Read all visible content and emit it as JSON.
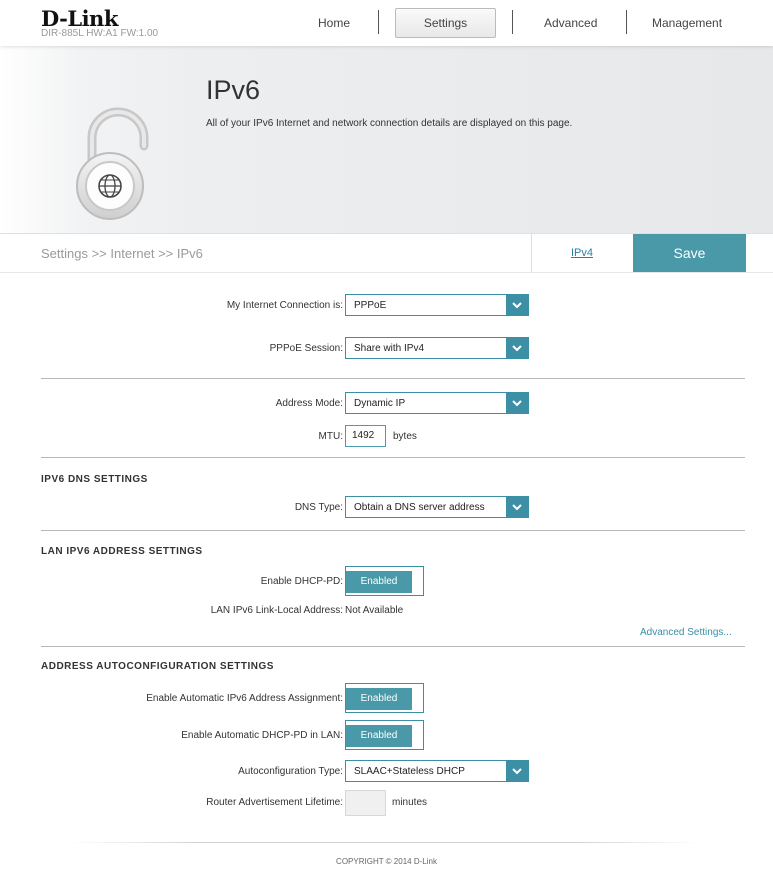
{
  "header": {
    "brand": "D-Link",
    "device_info": "DIR-885L  HW:A1  FW:1.00",
    "nav": [
      "Home",
      "Settings",
      "Advanced",
      "Management"
    ],
    "active_tab": "Settings"
  },
  "banner": {
    "title": "IPv6",
    "description": "All of your IPv6 Internet and network connection details are displayed on this page.",
    "icon": "lock-globe-icon"
  },
  "breadcrumb": "Settings >> Internet >> IPv6",
  "actions": {
    "ipv4_link": "IPv4",
    "save_label": "Save"
  },
  "form": {
    "connection_label": "My Internet Connection is:",
    "connection_value": "PPPoE",
    "session_label": "PPPoE Session:",
    "session_value": "Share with IPv4",
    "address_mode_label": "Address Mode:",
    "address_mode_value": "Dynamic IP",
    "mtu_label": "MTU:",
    "mtu_value": "1492",
    "mtu_unit": "bytes"
  },
  "dns": {
    "section_title": "IPV6 DNS SETTINGS",
    "dns_type_label": "DNS Type:",
    "dns_type_value": "Obtain a DNS server address"
  },
  "lan": {
    "section_title": "LAN IPV6 ADDRESS SETTINGS",
    "dhcp_pd_label": "Enable DHCP-PD:",
    "dhcp_pd_value": "Enabled",
    "link_local_label": "LAN IPv6 Link-Local Address:",
    "link_local_value": "Not Available",
    "advanced_link": "Advanced Settings..."
  },
  "autoconfig": {
    "section_title": "ADDRESS AUTOCONFIGURATION SETTINGS",
    "auto_assign_label": "Enable Automatic IPv6 Address Assignment:",
    "auto_assign_value": "Enabled",
    "auto_dhcp_label": "Enable Automatic DHCP-PD in LAN:",
    "auto_dhcp_value": "Enabled",
    "type_label": "Autoconfiguration Type:",
    "type_value": "SLAAC+Stateless DHCP",
    "lifetime_label": "Router Advertisement Lifetime:",
    "lifetime_value": "",
    "lifetime_unit": "minutes"
  },
  "footer": "COPYRIGHT © 2014 D-Link",
  "colors": {
    "accent": "#4a99a9",
    "link": "#2a7f9e"
  }
}
